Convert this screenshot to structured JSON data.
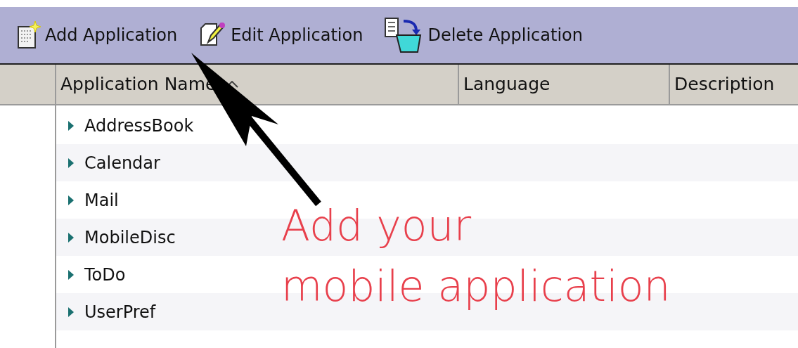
{
  "toolbar": {
    "buttons": [
      {
        "kind": "add",
        "label": "Add Application"
      },
      {
        "kind": "edit",
        "label": "Edit Application"
      },
      {
        "kind": "delete",
        "label": "Delete Application"
      }
    ]
  },
  "table": {
    "columns": [
      {
        "label": "Application Name",
        "sorted": true
      },
      {
        "label": "Language",
        "sorted": false
      },
      {
        "label": "Description",
        "sorted": false
      }
    ],
    "rows": [
      {
        "name": "AddressBook"
      },
      {
        "name": "Calendar"
      },
      {
        "name": "Mail"
      },
      {
        "name": "MobileDisc"
      },
      {
        "name": "ToDo"
      },
      {
        "name": "UserPref"
      }
    ]
  },
  "annotation": {
    "text": "Add your\nmobile application"
  }
}
